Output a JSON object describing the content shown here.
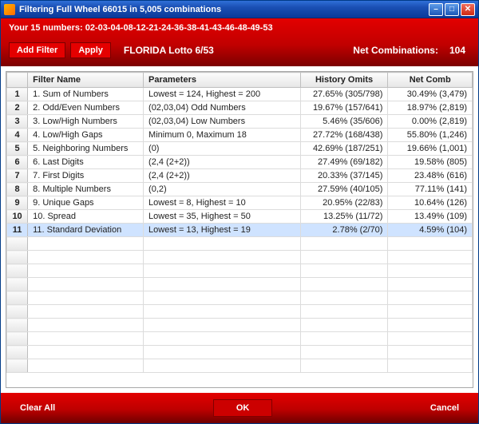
{
  "window_title": "Filtering Full Wheel 66015 in 5,005 combinations",
  "your_numbers": "Your 15 numbers: 02-03-04-08-12-21-24-36-38-41-43-46-48-49-53",
  "toolbar": {
    "add_filter": "Add Filter",
    "apply": "Apply",
    "lotto_name": "FLORIDA Lotto 6/53",
    "net_combinations_label": "Net Combinations:",
    "net_combinations_value": "104"
  },
  "columns": {
    "row": "",
    "filter_name": "Filter Name",
    "parameters": "Parameters",
    "history_omits": "History Omits",
    "net_comb": "Net Comb"
  },
  "rows": [
    {
      "n": "1",
      "name": "1. Sum of Numbers",
      "params": "Lowest = 124, Highest = 200",
      "hist": "27.65% (305/798)",
      "net": "30.49% (3,479)"
    },
    {
      "n": "2",
      "name": "2. Odd/Even Numbers",
      "params": "(02,03,04) Odd Numbers",
      "hist": "19.67% (157/641)",
      "net": "18.97% (2,819)"
    },
    {
      "n": "3",
      "name": "3. Low/High Numbers",
      "params": "(02,03,04) Low Numbers",
      "hist": "5.46% (35/606)",
      "net": "0.00% (2,819)"
    },
    {
      "n": "4",
      "name": "4. Low/High Gaps",
      "params": "Minimum 0, Maximum 18",
      "hist": "27.72% (168/438)",
      "net": "55.80% (1,246)"
    },
    {
      "n": "5",
      "name": "5. Neighboring Numbers",
      "params": "(0)",
      "hist": "42.69% (187/251)",
      "net": "19.66% (1,001)"
    },
    {
      "n": "6",
      "name": "6. Last Digits",
      "params": "(2,4 (2+2))",
      "hist": "27.49% (69/182)",
      "net": "19.58% (805)"
    },
    {
      "n": "7",
      "name": "7. First Digits",
      "params": "(2,4 (2+2))",
      "hist": "20.33% (37/145)",
      "net": "23.48% (616)"
    },
    {
      "n": "8",
      "name": "8. Multiple Numbers",
      "params": "(0,2)",
      "hist": "27.59% (40/105)",
      "net": "77.11% (141)"
    },
    {
      "n": "9",
      "name": "9. Unique Gaps",
      "params": "Lowest = 8, Highest = 10",
      "hist": "20.95% (22/83)",
      "net": "10.64% (126)"
    },
    {
      "n": "10",
      "name": "10. Spread",
      "params": "Lowest = 35, Highest = 50",
      "hist": "13.25% (11/72)",
      "net": "13.49% (109)"
    },
    {
      "n": "11",
      "name": "11. Standard Deviation",
      "params": "Lowest = 13, Highest = 19",
      "hist": "2.78% (2/70)",
      "net": "4.59% (104)"
    }
  ],
  "selected_row_index": 10,
  "empty_rows": 10,
  "footer": {
    "clear_all": "Clear All",
    "ok": "OK",
    "cancel": "Cancel"
  }
}
